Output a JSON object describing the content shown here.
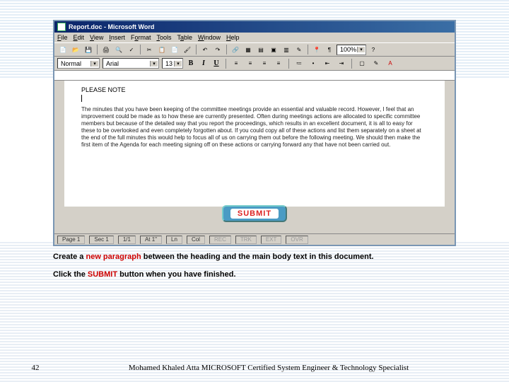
{
  "window": {
    "title": "Report.doc - Microsoft Word"
  },
  "menu": {
    "file": "File",
    "edit": "Edit",
    "view": "View",
    "insert": "Insert",
    "format": "Format",
    "tools": "Tools",
    "table": "Table",
    "window": "Window",
    "help": "Help"
  },
  "toolbar": {
    "zoom": "100%"
  },
  "format": {
    "style": "Normal",
    "font": "Arial",
    "size": "13",
    "bold": "B",
    "italic": "I",
    "underline": "U"
  },
  "document": {
    "heading": "PLEASE NOTE",
    "body": "The minutes that you have been keeping of the committee meetings provide an essential and valuable record. However, I feel that an improvement could be made as to how these are currently presented. Often during meetings actions are allocated to specific committee members but because of the detailed way that you report the proceedings, which results in an excellent document, it is all to easy for these to be overlooked and even completely forgotten about. If you could copy all of these actions and list them separately on a sheet at the end of the full minutes this would help to focus all of us on carrying them out before the following meeting. We should then make the first item of the Agenda for each meeting signing off on these actions or carrying forward any that have not been carried out."
  },
  "submit": {
    "label": "SUBMIT"
  },
  "status": {
    "page": "Page 1",
    "sec": "Sec 1",
    "pages": "1/1",
    "at": "At 1\"",
    "ln": "Ln",
    "col": "Col",
    "rec": "REC",
    "trk": "TRK",
    "ext": "EXT",
    "ovr": "OVR"
  },
  "instructions": {
    "line1a": "Create a ",
    "line1b": "new paragraph",
    "line1c": " between the heading and the main body text in this document.",
    "line2a": "Click the ",
    "line2b": "SUBMIT",
    "line2c": " button when you have finished."
  },
  "footer": {
    "page": "42",
    "credit": "Mohamed Khaled Atta MICROSOFT Certified System Engineer & Technology Specialist"
  }
}
